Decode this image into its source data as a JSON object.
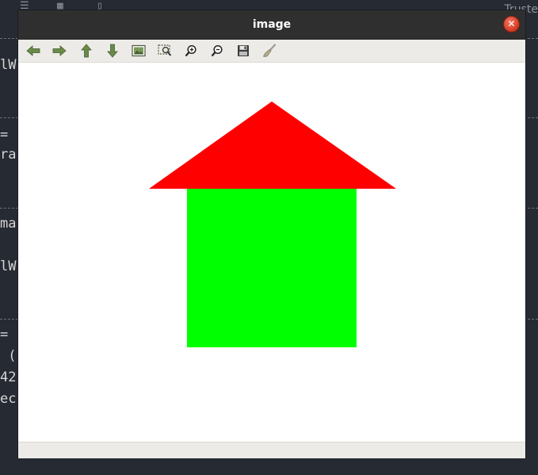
{
  "window": {
    "title": "image"
  },
  "background_editor": {
    "title_fragment": "Truste",
    "lines": [
      "lW",
      "=",
      "ra",
      "ma",
      "lW",
      "=",
      " (",
      "42",
      "ec"
    ]
  },
  "toolbar": {
    "buttons": [
      {
        "name": "back-arrow-icon",
        "tooltip": ""
      },
      {
        "name": "forward-arrow-icon",
        "tooltip": ""
      },
      {
        "name": "up-arrow-icon",
        "tooltip": ""
      },
      {
        "name": "down-arrow-icon",
        "tooltip": ""
      },
      {
        "name": "image-icon",
        "tooltip": ""
      },
      {
        "name": "zoom-region-icon",
        "tooltip": ""
      },
      {
        "name": "zoom-in-icon",
        "tooltip": ""
      },
      {
        "name": "zoom-out-icon",
        "tooltip": ""
      },
      {
        "name": "save-icon",
        "tooltip": ""
      },
      {
        "name": "brush-icon",
        "tooltip": ""
      }
    ]
  },
  "image": {
    "shapes": [
      {
        "name": "roof-triangle",
        "kind": "triangle",
        "color": "#ff0000"
      },
      {
        "name": "house-square",
        "kind": "rectangle",
        "color": "#00ff00"
      }
    ]
  },
  "colors": {
    "titlebar": "#2f2f2f",
    "toolbar": "#edebe7",
    "close": "#e0452c",
    "icon_green": "#6a8a4a"
  }
}
